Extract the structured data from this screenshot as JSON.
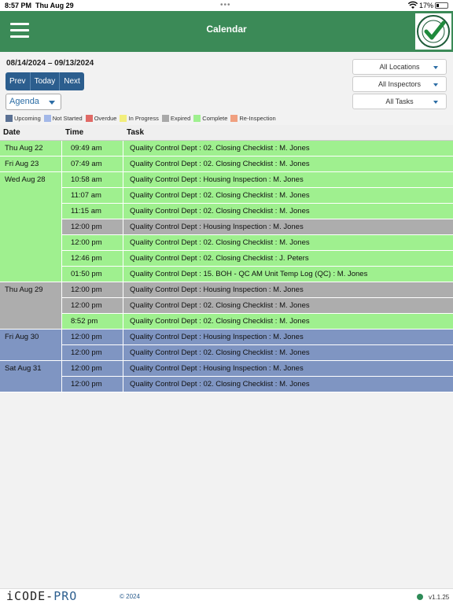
{
  "status_bar": {
    "time": "8:57 PM",
    "date": "Thu Aug 29",
    "battery": "17%"
  },
  "app": {
    "title": "Calendar"
  },
  "range": "08/14/2024 – 09/13/2024",
  "nav": {
    "prev": "Prev",
    "today": "Today",
    "next": "Next"
  },
  "view": "Agenda",
  "filters": {
    "locations": "All Locations",
    "inspectors": "All Inspectors",
    "tasks": "All Tasks"
  },
  "legend": [
    {
      "label": "Upcoming",
      "color": "#5b7194"
    },
    {
      "label": "Not Started",
      "color": "#a3b8e8"
    },
    {
      "label": "Overdue",
      "color": "#e06a66"
    },
    {
      "label": "In Progress",
      "color": "#f2ee7c"
    },
    {
      "label": "Expired",
      "color": "#a9a9a9"
    },
    {
      "label": "Complete",
      "color": "#9ff08f"
    },
    {
      "label": "Re-Inspection",
      "color": "#f0a080"
    }
  ],
  "columns": {
    "date": "Date",
    "time": "Time",
    "task": "Task"
  },
  "colors": {
    "complete": "#9ff08f",
    "expired": "#adadad",
    "upcoming": "#7f95c2"
  },
  "days": [
    {
      "date": "Thu Aug 22",
      "status": "complete",
      "rows": [
        {
          "time": "09:49 am",
          "task": "Quality Control Dept : 02. Closing Checklist : M. Jones",
          "status": "complete"
        }
      ]
    },
    {
      "date": "Fri Aug 23",
      "status": "complete",
      "rows": [
        {
          "time": "07:49 am",
          "task": "Quality Control Dept : 02. Closing Checklist : M. Jones",
          "status": "complete"
        }
      ]
    },
    {
      "date": "Wed Aug 28",
      "status": "complete",
      "rows": [
        {
          "time": "10:58 am",
          "task": "Quality Control Dept : Housing Inspection : M. Jones",
          "status": "complete"
        },
        {
          "time": "11:07 am",
          "task": "Quality Control Dept : 02. Closing Checklist : M. Jones",
          "status": "complete"
        },
        {
          "time": "11:15 am",
          "task": "Quality Control Dept : 02. Closing Checklist : M. Jones",
          "status": "complete"
        },
        {
          "time": "12:00 pm",
          "task": "Quality Control Dept : Housing Inspection : M. Jones",
          "status": "expired"
        },
        {
          "time": "12:00 pm",
          "task": "Quality Control Dept : 02. Closing Checklist : M. Jones",
          "status": "complete"
        },
        {
          "time": "12:46 pm",
          "task": "Quality Control Dept : 02. Closing Checklist : J. Peters",
          "status": "complete"
        },
        {
          "time": "01:50 pm",
          "task": "Quality Control Dept : 15. BOH - QC AM Unit Temp Log (QC) : M. Jones",
          "status": "complete"
        }
      ]
    },
    {
      "date": "Thu Aug 29",
      "status": "expired",
      "rows": [
        {
          "time": "12:00 pm",
          "task": "Quality Control Dept : Housing Inspection : M. Jones",
          "status": "expired"
        },
        {
          "time": "12:00 pm",
          "task": "Quality Control Dept : 02. Closing Checklist : M. Jones",
          "status": "expired"
        },
        {
          "time": "8:52 pm",
          "task": "Quality Control Dept : 02. Closing Checklist : M. Jones",
          "status": "complete"
        }
      ]
    },
    {
      "date": "Fri Aug 30",
      "status": "upcoming",
      "rows": [
        {
          "time": "12:00 pm",
          "task": "Quality Control Dept : Housing Inspection : M. Jones",
          "status": "upcoming"
        },
        {
          "time": "12:00 pm",
          "task": "Quality Control Dept : 02. Closing Checklist : M. Jones",
          "status": "upcoming"
        }
      ]
    },
    {
      "date": "Sat Aug 31",
      "status": "upcoming",
      "rows": [
        {
          "time": "12:00 pm",
          "task": "Quality Control Dept : Housing Inspection : M. Jones",
          "status": "upcoming"
        },
        {
          "time": "12:00 pm",
          "task": "Quality Control Dept : 02. Closing Checklist : M. Jones",
          "status": "upcoming"
        }
      ]
    }
  ],
  "footer": {
    "brand_main": "iCODE-",
    "brand_pro": "PRO",
    "copyright": "© 2024",
    "version": "v1.1.25"
  },
  "logo_text": "QUALITY CONTROL APPROVED"
}
